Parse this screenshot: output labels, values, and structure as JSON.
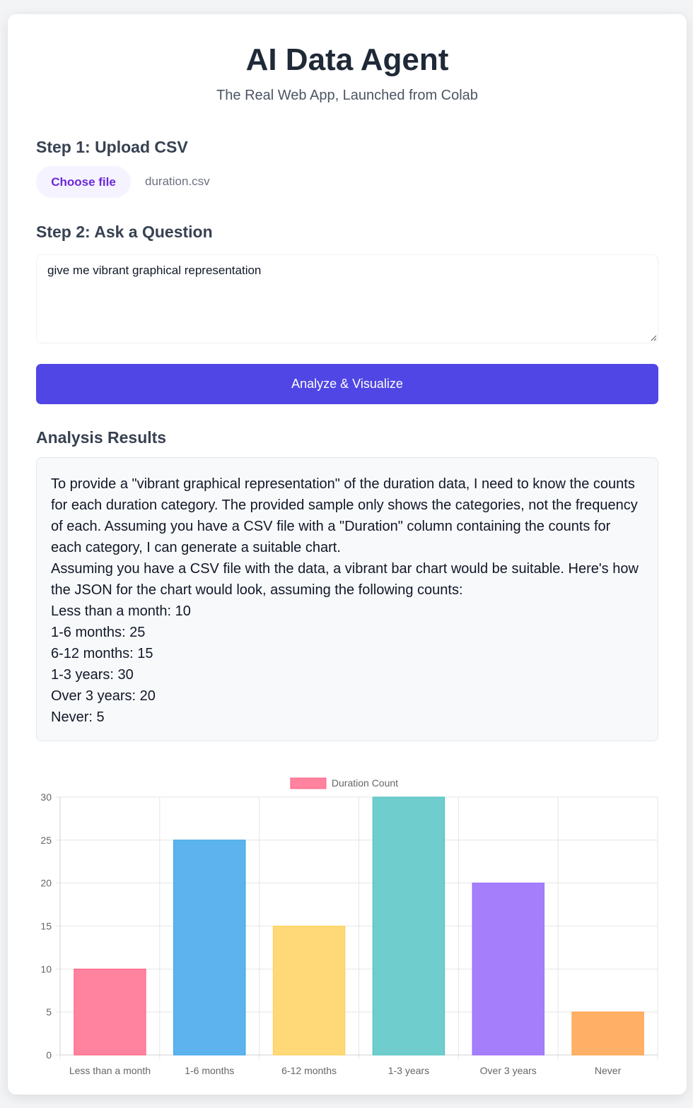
{
  "header": {
    "title": "AI Data Agent",
    "subtitle": "The Real Web App, Launched from Colab"
  },
  "step1": {
    "heading": "Step 1: Upload CSV",
    "button_label": "Choose file",
    "file_name": "duration.csv"
  },
  "step2": {
    "heading": "Step 2: Ask a Question",
    "question_value": "give me vibrant graphical representation"
  },
  "analyze_button": {
    "label": "Analyze & Visualize"
  },
  "results": {
    "heading": "Analysis Results",
    "lines": [
      "To provide a \"vibrant graphical representation\" of the duration data, I need to know the counts for each duration category. The provided sample only shows the categories, not the frequency of each. Assuming you have a CSV file with a \"Duration\" column containing the counts for each category, I can generate a suitable chart.",
      "Assuming you have a CSV file with the data, a vibrant bar chart would be suitable. Here's how the JSON for the chart would look, assuming the following counts:",
      "Less than a month: 10",
      "1-6 months: 25",
      "6-12 months: 15",
      "1-3 years: 30",
      "Over 3 years: 20",
      "Never: 5"
    ]
  },
  "chart_data": {
    "type": "bar",
    "categories": [
      "Less than a month",
      "1-6 months",
      "6-12 months",
      "1-3 years",
      "Over 3 years",
      "Never"
    ],
    "series": [
      {
        "name": "Duration Count",
        "values": [
          10,
          25,
          15,
          30,
          20,
          5
        ],
        "colors": [
          "#ff829f",
          "#5db3ee",
          "#ffd977",
          "#6fcdcd",
          "#a57ffb",
          "#ffb066"
        ],
        "border_colors": [
          "#ff6384",
          "#36a2eb",
          "#ffce56",
          "#4bc0c0",
          "#9966ff",
          "#ff9f40"
        ]
      }
    ],
    "yticks": [
      0,
      5,
      10,
      15,
      20,
      25,
      30
    ],
    "ylim": [
      0,
      30
    ],
    "legend": "top-center",
    "grid": true,
    "title": "",
    "xlabel": "",
    "ylabel": ""
  },
  "colors": {
    "accent": "#4f46e5",
    "file_button_bg": "#f5f3ff",
    "file_button_text": "#6d28d9",
    "legend_swatch": "#ff829f"
  }
}
